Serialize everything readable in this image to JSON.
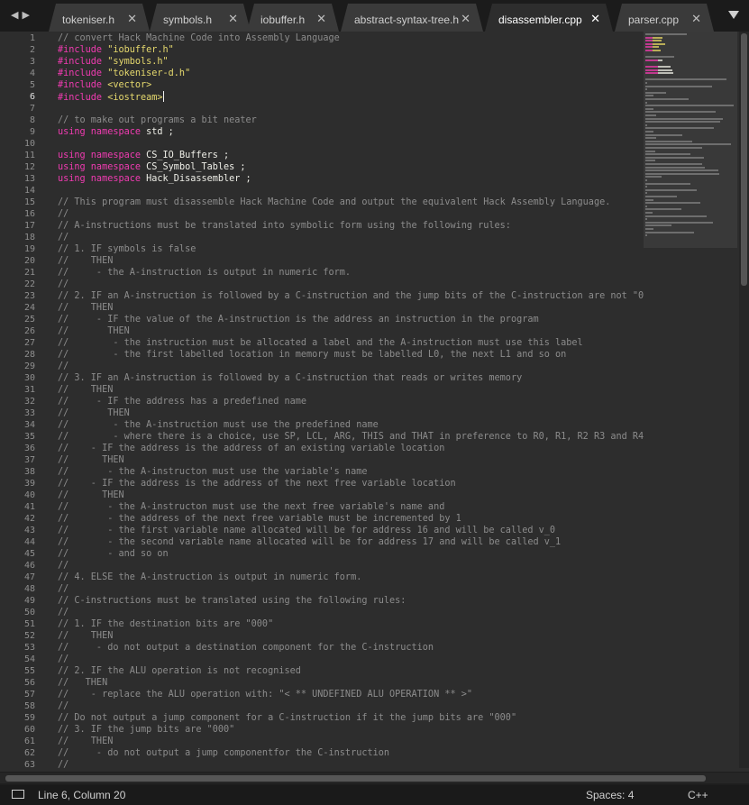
{
  "tabs": [
    {
      "label": "tokeniser.h",
      "active": false
    },
    {
      "label": "symbols.h",
      "active": false
    },
    {
      "label": "iobuffer.h",
      "active": false
    },
    {
      "label": "abstract-syntax-tree.h",
      "active": false
    },
    {
      "label": "disassembler.cpp",
      "active": true
    },
    {
      "label": "parser.cpp",
      "active": false
    }
  ],
  "editor": {
    "current_line": 6,
    "line_numbers": [
      "1",
      "2",
      "3",
      "4",
      "5",
      "6",
      "7",
      "8",
      "9",
      "10",
      "11",
      "12",
      "13",
      "14",
      "15",
      "16",
      "17",
      "18",
      "19",
      "20",
      "21",
      "22",
      "23",
      "24",
      "25",
      "26",
      "27",
      "28",
      "29",
      "30",
      "31",
      "32",
      "33",
      "34",
      "35",
      "36",
      "37",
      "38",
      "39",
      "40",
      "41",
      "42",
      "43",
      "44",
      "45",
      "46",
      "47",
      "48",
      "49",
      "50",
      "51",
      "52",
      "53",
      "54",
      "55",
      "56",
      "57",
      "58",
      "59",
      "60",
      "61",
      "62",
      "63"
    ],
    "lines": [
      [
        [
          "c",
          "// convert Hack Machine Code into Assembly Language"
        ]
      ],
      [
        [
          "k",
          "#include "
        ],
        [
          "s",
          "\"iobuffer.h\""
        ]
      ],
      [
        [
          "k",
          "#include "
        ],
        [
          "s",
          "\"symbols.h\""
        ]
      ],
      [
        [
          "k",
          "#include "
        ],
        [
          "s",
          "\"tokeniser-d.h\""
        ]
      ],
      [
        [
          "k",
          "#include "
        ],
        [
          "s",
          "<vector>"
        ]
      ],
      [
        [
          "k",
          "#include "
        ],
        [
          "s",
          "<iostream>"
        ]
      ],
      [],
      [
        [
          "c",
          "// to make out programs a bit neater"
        ]
      ],
      [
        [
          "k",
          "using namespace "
        ],
        [
          "p",
          "std ;"
        ]
      ],
      [],
      [
        [
          "k",
          "using namespace "
        ],
        [
          "p",
          "CS_IO_Buffers ;"
        ]
      ],
      [
        [
          "k",
          "using namespace "
        ],
        [
          "p",
          "CS_Symbol_Tables ;"
        ]
      ],
      [
        [
          "k",
          "using namespace "
        ],
        [
          "p",
          "Hack_Disassembler ;"
        ]
      ],
      [],
      [
        [
          "c",
          "// This program must disassemble Hack Machine Code and output the equivalent Hack Assembly Language."
        ]
      ],
      [
        [
          "c",
          "//"
        ]
      ],
      [
        [
          "c",
          "// A-instructions must be translated into symbolic form using the following rules:"
        ]
      ],
      [
        [
          "c",
          "//"
        ]
      ],
      [
        [
          "c",
          "// 1. IF symbols is false"
        ]
      ],
      [
        [
          "c",
          "//    THEN"
        ]
      ],
      [
        [
          "c",
          "//     - the A-instruction is output in numeric form."
        ]
      ],
      [
        [
          "c",
          "//"
        ]
      ],
      [
        [
          "c",
          "// 2. IF an A-instruction is followed by a C-instruction and the jump bits of the C-instruction are not \"000\""
        ]
      ],
      [
        [
          "c",
          "//    THEN"
        ]
      ],
      [
        [
          "c",
          "//     - IF the value of the A-instruction is the address an instruction in the program"
        ]
      ],
      [
        [
          "c",
          "//       THEN"
        ]
      ],
      [
        [
          "c",
          "//        - the instruction must be allocated a label and the A-instruction must use this label"
        ]
      ],
      [
        [
          "c",
          "//        - the first labelled location in memory must be labelled L0, the next L1 and so on"
        ]
      ],
      [
        [
          "c",
          "//"
        ]
      ],
      [
        [
          "c",
          "// 3. IF an A-instruction is followed by a C-instruction that reads or writes memory"
        ]
      ],
      [
        [
          "c",
          "//    THEN"
        ]
      ],
      [
        [
          "c",
          "//     - IF the address has a predefined name"
        ]
      ],
      [
        [
          "c",
          "//       THEN"
        ]
      ],
      [
        [
          "c",
          "//        - the A-instruction must use the predefined name"
        ]
      ],
      [
        [
          "c",
          "//        - where there is a choice, use SP, LCL, ARG, THIS and THAT in preference to R0, R1, R2 R3 and R4"
        ]
      ],
      [
        [
          "c",
          "//    - IF the address is the address of an existing variable location"
        ]
      ],
      [
        [
          "c",
          "//      THEN"
        ]
      ],
      [
        [
          "c",
          "//       - the A-instructon must use the variable's name"
        ]
      ],
      [
        [
          "c",
          "//    - IF the address is the address of the next free variable location"
        ]
      ],
      [
        [
          "c",
          "//      THEN"
        ]
      ],
      [
        [
          "c",
          "//       - the A-instructon must use the next free variable's name and"
        ]
      ],
      [
        [
          "c",
          "//       - the address of the next free variable must be incremented by 1"
        ]
      ],
      [
        [
          "c",
          "//       - the first variable name allocated will be for address 16 and will be called v_0"
        ]
      ],
      [
        [
          "c",
          "//       - the second variable name allocated will be for address 17 and will be called v_1"
        ]
      ],
      [
        [
          "c",
          "//       - and so on"
        ]
      ],
      [
        [
          "c",
          "//"
        ]
      ],
      [
        [
          "c",
          "// 4. ELSE the A-instruction is output in numeric form."
        ]
      ],
      [
        [
          "c",
          "//"
        ]
      ],
      [
        [
          "c",
          "// C-instructions must be translated using the following rules:"
        ]
      ],
      [
        [
          "c",
          "//"
        ]
      ],
      [
        [
          "c",
          "// 1. IF the destination bits are \"000\""
        ]
      ],
      [
        [
          "c",
          "//    THEN"
        ]
      ],
      [
        [
          "c",
          "//     - do not output a destination component for the C-instruction"
        ]
      ],
      [
        [
          "c",
          "//"
        ]
      ],
      [
        [
          "c",
          "// 2. IF the ALU operation is not recognised"
        ]
      ],
      [
        [
          "c",
          "//   THEN"
        ]
      ],
      [
        [
          "c",
          "//    - replace the ALU operation with: \"< ** UNDEFINED ALU OPERATION ** >\""
        ]
      ],
      [
        [
          "c",
          "//"
        ]
      ],
      [
        [
          "c",
          "// Do not output a jump component for a C-instruction if it the jump bits are \"000\""
        ]
      ],
      [
        [
          "c",
          "// 3. IF the jump bits are \"000\""
        ]
      ],
      [
        [
          "c",
          "//    THEN"
        ]
      ],
      [
        [
          "c",
          "//     - do not output a jump componentfor the C-instruction"
        ]
      ],
      [
        [
          "c",
          "//"
        ]
      ]
    ]
  },
  "status": {
    "position": "Line 6, Column 20",
    "indentation": "Spaces: 4",
    "syntax": "C++"
  },
  "colors": {
    "comment": "#8c8c8c",
    "keyword": "#f13bb2",
    "string": "#e5d86d",
    "plain": "#efefe8",
    "background": "#2d2d2d"
  },
  "icons": [
    "back-arrow-icon",
    "forward-arrow-icon",
    "close-icon",
    "tab-list-dropdown-icon",
    "panel-toggle-icon"
  ]
}
